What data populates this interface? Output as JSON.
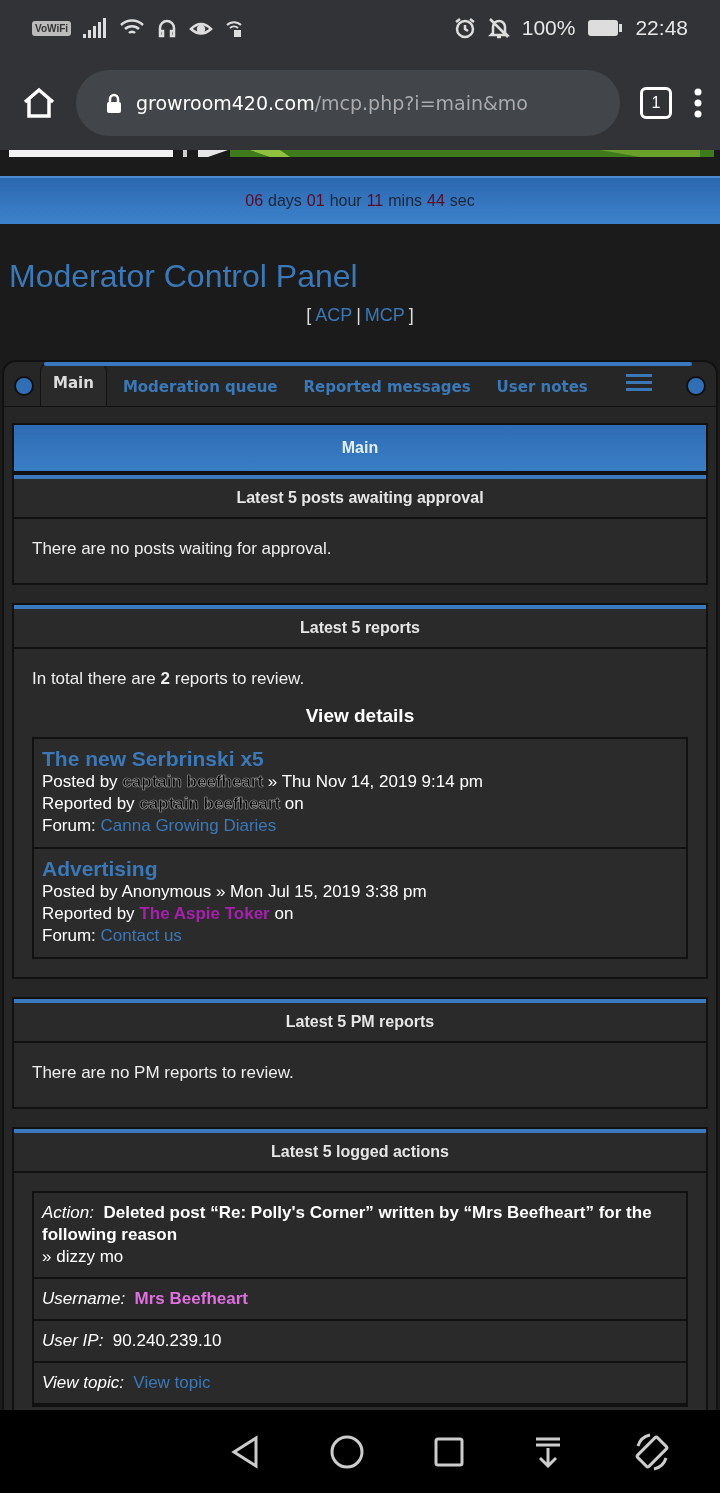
{
  "status_bar": {
    "carrier_badge": "VoWiFi",
    "battery": "100%",
    "time": "22:48"
  },
  "browser": {
    "domain": "growroom420.com",
    "path": "/mcp.php?i=main&mo",
    "tab_count": "1"
  },
  "countdown": [
    {
      "value": "06",
      "unit": "days"
    },
    {
      "value": "01",
      "unit": "hour"
    },
    {
      "value": "11",
      "unit": "mins"
    },
    {
      "value": "44",
      "unit": "sec"
    }
  ],
  "page_title": "Moderator Control Panel",
  "quick_links": {
    "open": "[",
    "links": [
      "ACP",
      "MCP"
    ],
    "separator": "|",
    "close": "]"
  },
  "tabs": [
    {
      "label": "Main",
      "selected": true
    },
    {
      "label": "Moderation queue",
      "selected": false
    },
    {
      "label": "Reported messages",
      "selected": false
    },
    {
      "label": "User notes",
      "selected": false
    }
  ],
  "panel_title": "Main",
  "sections": [
    {
      "kind": "message",
      "title": "Latest 5 posts awaiting approval",
      "text": "There are no posts waiting for approval."
    },
    {
      "kind": "reports",
      "title": "Latest 5 reports",
      "text": "In total there are **2** reports to review.",
      "subheading": "View details",
      "reports": [
        {
          "title": "The new Serbrinski x5",
          "posted_label": "Posted by",
          "poster": {
            "name": "captain beefheart",
            "color": "#000000"
          },
          "date": "» Thu Nov 14, 2019 9:14 pm",
          "reported_label": "Reported by",
          "reporter": {
            "name": "captain beefheart",
            "color": "#000000"
          },
          "reported_suffix": "on",
          "forum_label": "Forum:",
          "forum": "Canna Growing Diaries"
        },
        {
          "title": "Advertising",
          "posted_label": "Posted by",
          "poster": {
            "name": "Anonymous"
          },
          "date": "» Mon Jul 15, 2019 3:38 pm",
          "reported_label": "Reported by",
          "reporter": {
            "name": "The Aspie Toker",
            "color": "#a81fb0"
          },
          "reported_suffix": "on",
          "forum_label": "Forum:",
          "forum": "Contact us"
        }
      ]
    },
    {
      "kind": "message",
      "title": "Latest 5 PM reports",
      "text": "There are no PM reports to review."
    },
    {
      "kind": "log",
      "title": "Latest 5 logged actions",
      "rows": [
        {
          "kind": "action",
          "label": "Action:",
          "value": "Deleted post “Re: Polly's Corner” written by “Mrs Beefheart” for the following reason",
          "detail": "» dizzy mo"
        },
        {
          "kind": "user",
          "label": "Username:",
          "value": "Mrs Beefheart",
          "color": "#e070e0"
        },
        {
          "kind": "text",
          "label": "User IP:",
          "value": "90.240.239.10"
        },
        {
          "kind": "link",
          "label": "View topic:",
          "value": "View topic"
        }
      ]
    }
  ]
}
